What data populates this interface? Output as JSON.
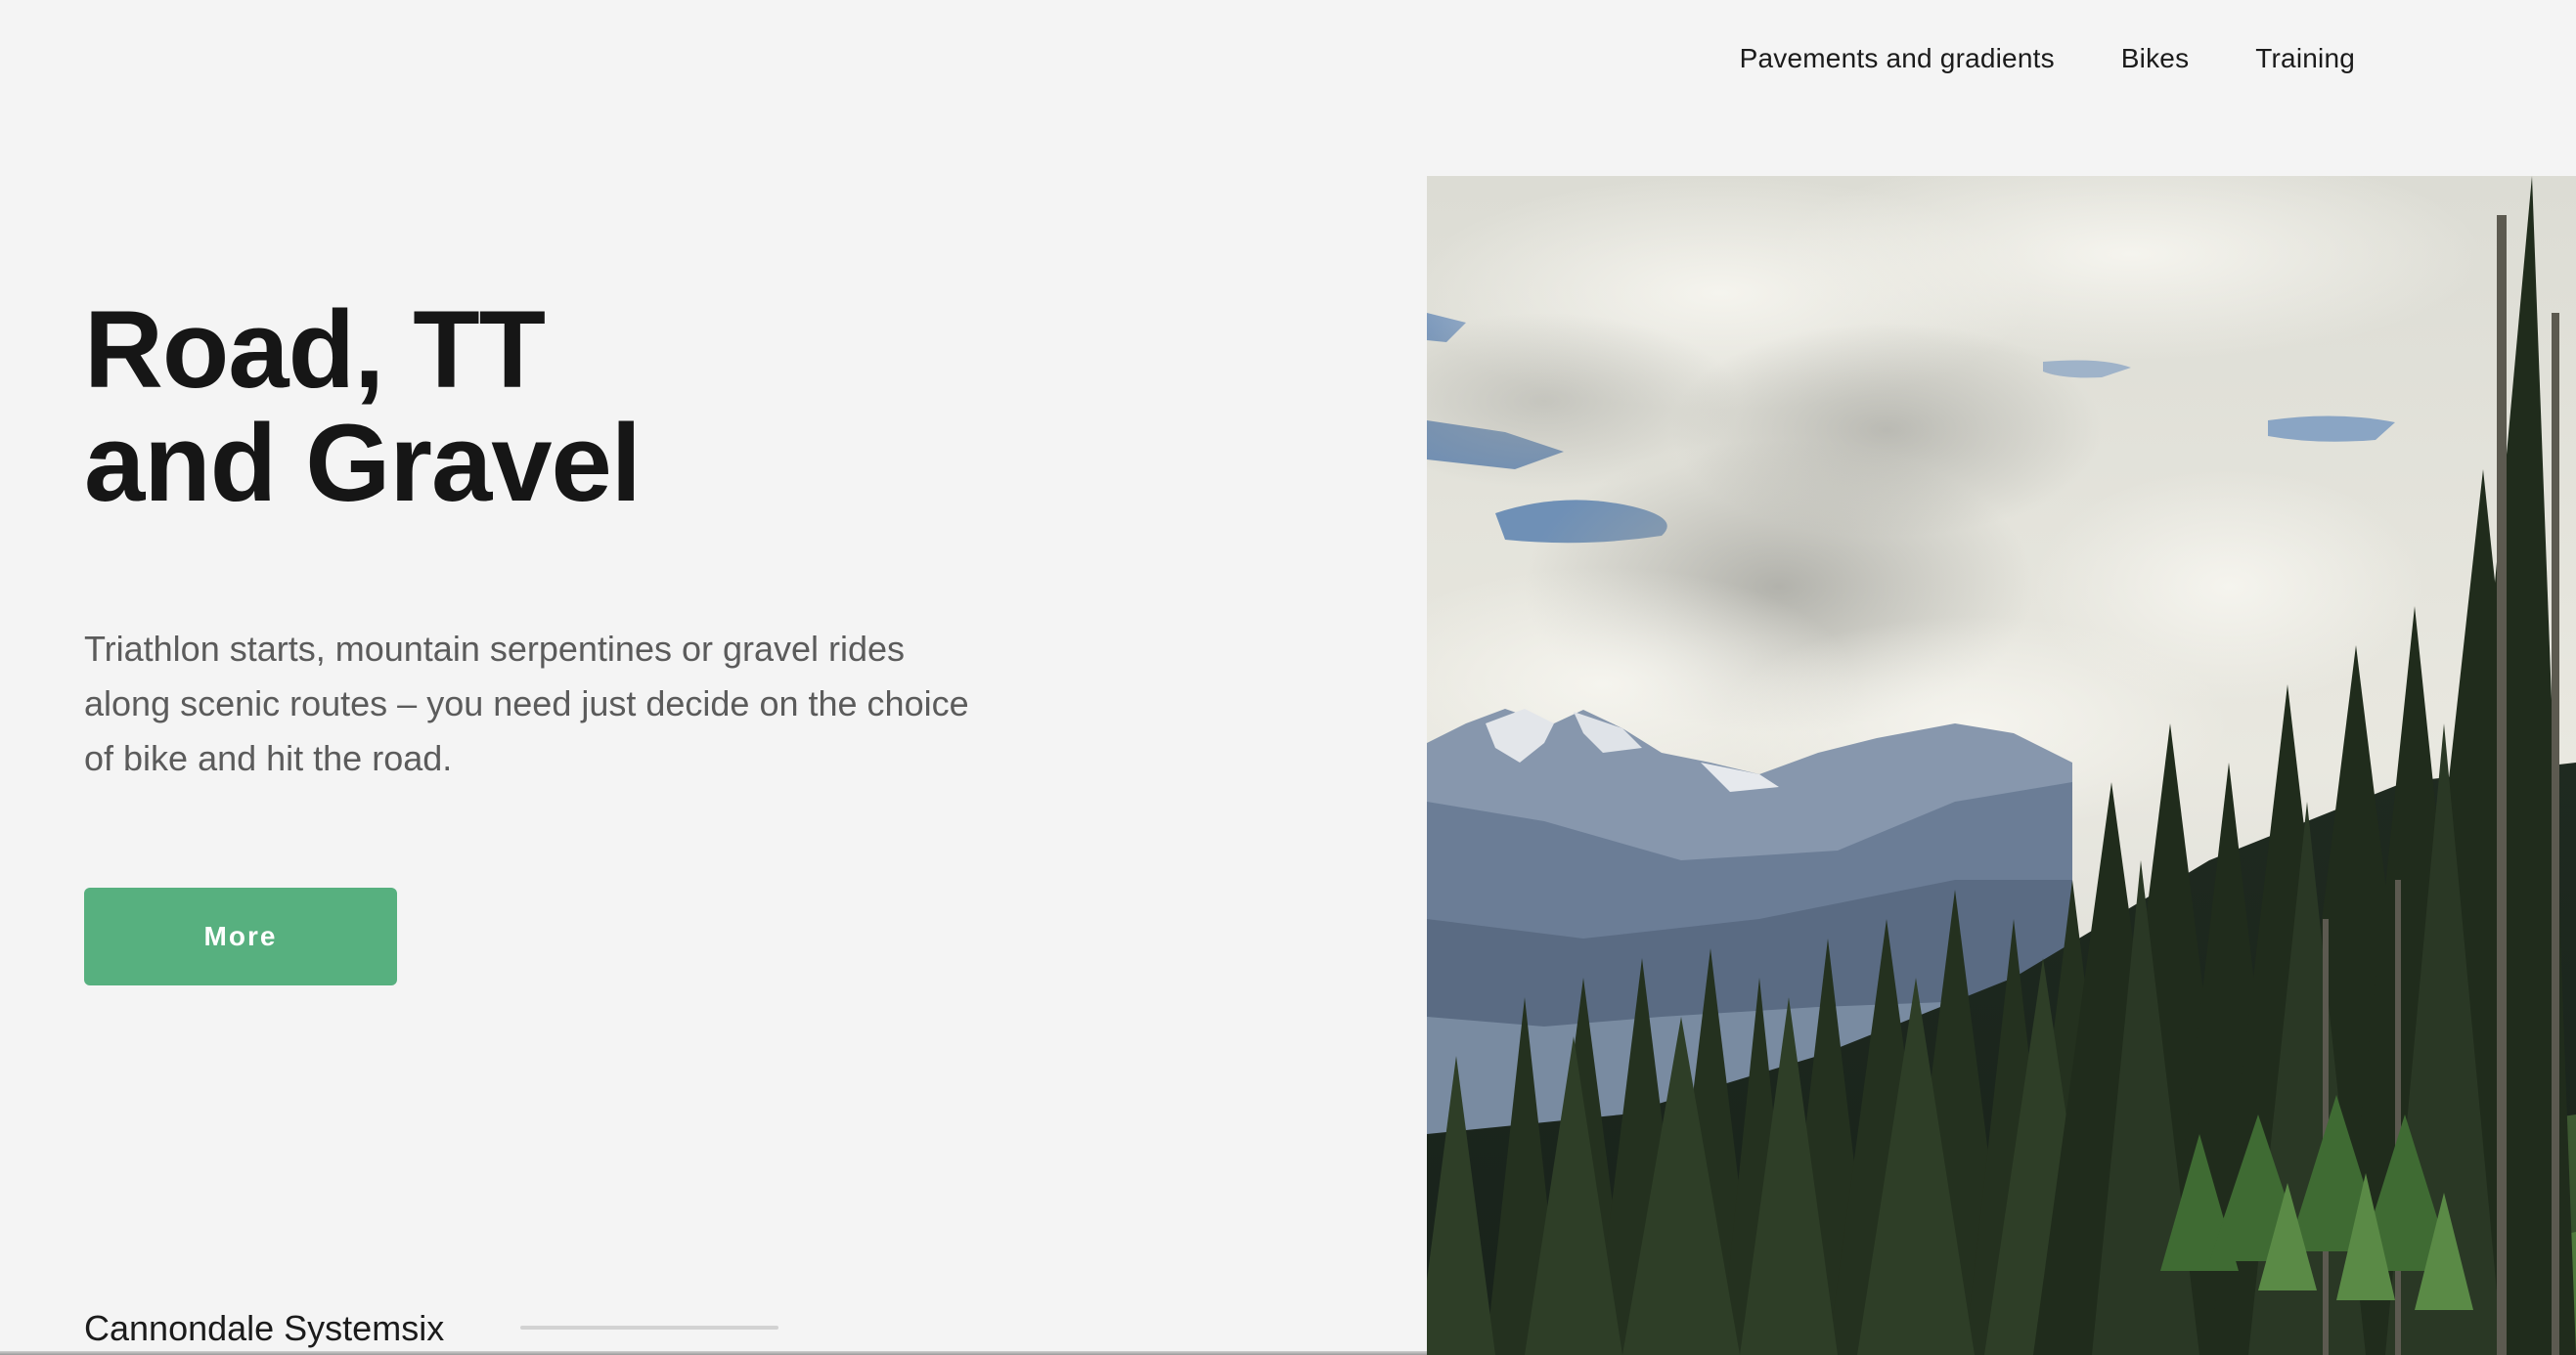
{
  "nav": {
    "items": [
      {
        "label": "Pavements and gradients"
      },
      {
        "label": "Bikes"
      },
      {
        "label": "Training"
      }
    ]
  },
  "hero": {
    "title_line1": "Road, TT",
    "title_line2": "and Gravel",
    "description": "Triathlon starts, mountain serpentines or gravel rides along scenic routes – you need just decide on the choice of bike and hit the road.",
    "cta_label": "More",
    "image": {
      "subject": "mountain forest landscape with cloudy sky"
    }
  },
  "slider": {
    "current_title": "Cannondale Systemsix",
    "progress": 0
  },
  "colors": {
    "background": "#f4f4f4",
    "accent": "#57b07f",
    "heading": "#161616",
    "body_text": "#5b5b5b"
  }
}
